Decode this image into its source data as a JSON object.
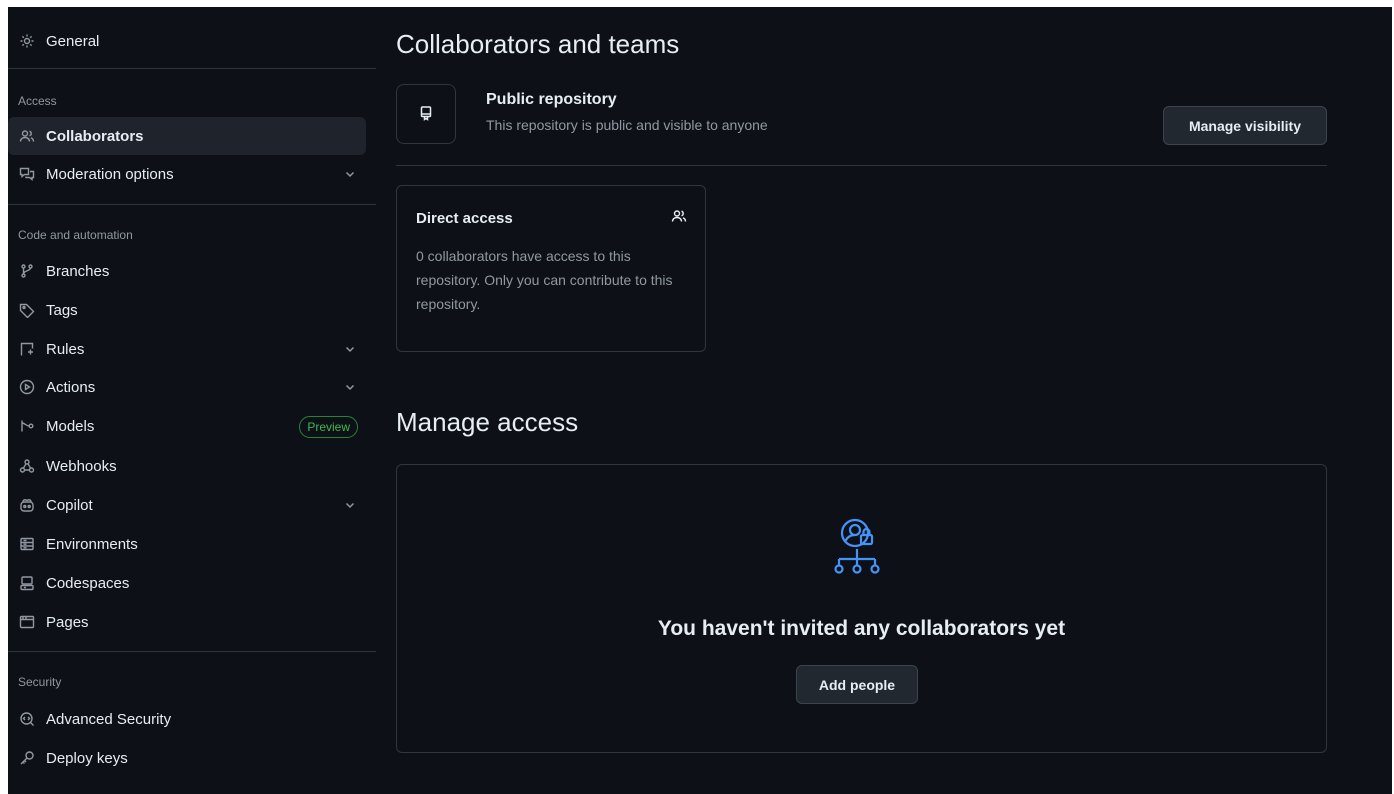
{
  "sidebar": {
    "general": "General",
    "access_heading": "Access",
    "collaborators": "Collaborators",
    "moderation": "Moderation options",
    "code_heading": "Code and automation",
    "branches": "Branches",
    "tags": "Tags",
    "rules": "Rules",
    "actions": "Actions",
    "models": "Models",
    "models_badge": "Preview",
    "webhooks": "Webhooks",
    "copilot": "Copilot",
    "environments": "Environments",
    "codespaces": "Codespaces",
    "pages": "Pages",
    "security_heading": "Security",
    "advanced_security": "Advanced Security",
    "deploy_keys": "Deploy keys"
  },
  "main": {
    "title": "Collaborators and teams",
    "visibility": {
      "title": "Public repository",
      "description": "This repository is public and visible to anyone",
      "button": "Manage visibility"
    },
    "direct_access": {
      "title": "Direct access",
      "text": "0 collaborators have access to this repository. Only you can contribute to this repository."
    },
    "manage_access": {
      "title": "Manage access",
      "empty_message": "You haven't invited any collaborators yet",
      "button": "Add people"
    }
  },
  "colors": {
    "background": "#0d1117",
    "border": "#30363d",
    "accent_blue": "#4493f8",
    "badge_green": "#3fb950"
  }
}
